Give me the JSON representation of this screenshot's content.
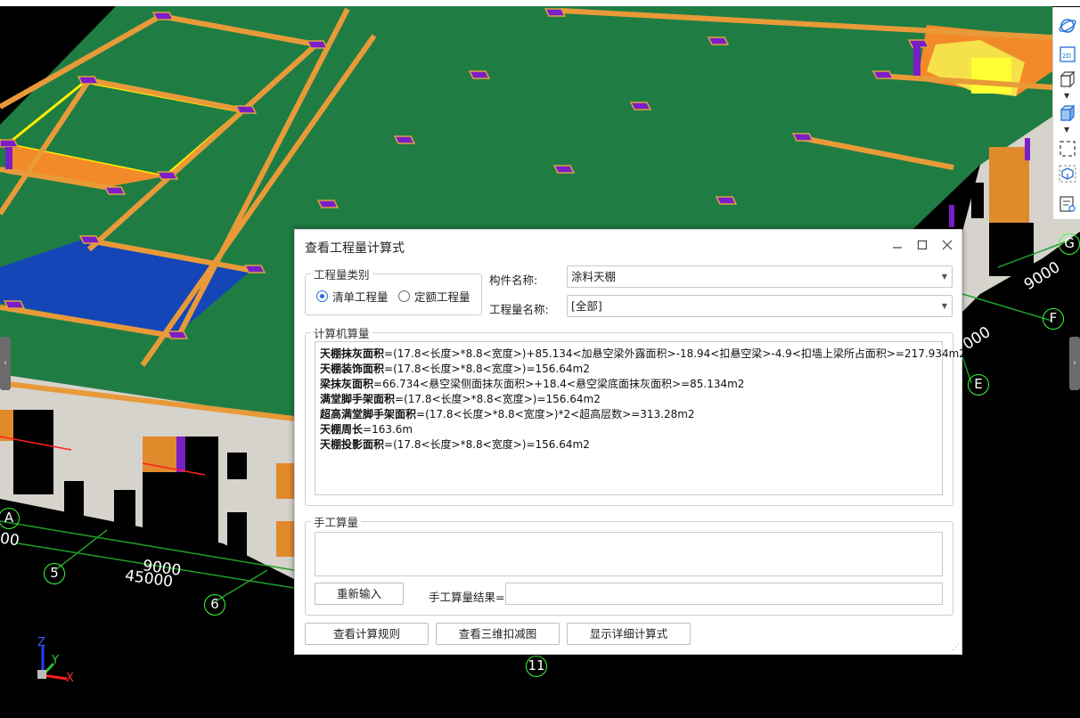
{
  "scene": {
    "axis_labels": {
      "z": "Z",
      "y": "Y",
      "x": "X"
    },
    "grid_markers": [
      "G",
      "F",
      "E",
      "A",
      "5",
      "6",
      "11"
    ],
    "dimensions": [
      "9000",
      "000",
      "00",
      "9000",
      "45000"
    ]
  },
  "toolbar": {
    "icons": [
      "orbit-icon",
      "2d-view-icon",
      "3d-box-icon",
      "3d-box-filled-icon",
      "select-frame-icon",
      "cube-outline-icon",
      "view-list-icon"
    ]
  },
  "dialog": {
    "title": "查看工程量计算式",
    "quantity_type_group": {
      "legend": "工程量类别",
      "options": [
        {
          "label": "清单工程量",
          "selected": true
        },
        {
          "label": "定额工程量",
          "selected": false
        }
      ]
    },
    "component_name_label": "构件名称:",
    "component_name_value": "涂料天棚",
    "quantity_name_label": "工程量名称:",
    "quantity_name_value": "[全部]",
    "computer_group_legend": "计算机算量",
    "formulas": [
      {
        "name": "天棚抹灰面积",
        "expr": "=(17.8<长度>*8.8<宽度>)+85.134<加悬空梁外露面积>-18.94<扣悬空梁>-4.9<扣墙上梁所占面积>=217.934m2"
      },
      {
        "name": "天棚装饰面积",
        "expr": "=(17.8<长度>*8.8<宽度>)=156.64m2"
      },
      {
        "name": "梁抹灰面积",
        "expr": "=66.734<悬空梁侧面抹灰面积>+18.4<悬空梁底面抹灰面积>=85.134m2"
      },
      {
        "name": "满堂脚手架面积",
        "expr": "=(17.8<长度>*8.8<宽度>)=156.64m2"
      },
      {
        "name": "超高满堂脚手架面积",
        "expr": "=(17.8<长度>*8.8<宽度>)*2<超高层数>=313.28m2"
      },
      {
        "name": "天棚周长",
        "expr": "=163.6m"
      },
      {
        "name": "天棚投影面积",
        "expr": "=(17.8<长度>*8.8<宽度>)=156.64m2"
      }
    ],
    "manual_group_legend": "手工算量",
    "reenter_button": "重新输入",
    "manual_result_label": "手工算量结果=",
    "manual_result_value": "",
    "view_rules_button": "查看计算规则",
    "view_3d_button": "查看三维扣减图",
    "show_detail_button": "显示详细计算式"
  }
}
